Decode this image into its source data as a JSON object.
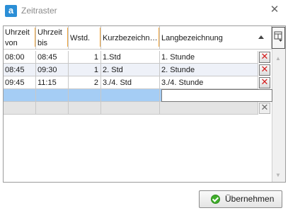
{
  "window": {
    "title": "Zeitraster",
    "app_icon_letter": "a",
    "close_glyph": "✕"
  },
  "table": {
    "headers": [
      {
        "line1": "Uhrzeit",
        "line2": "von"
      },
      {
        "line1": "Uhrzeit",
        "line2": "bis"
      },
      {
        "line1": "Wstd.",
        "line2": ""
      },
      {
        "line1": "Kurzbezeichn…",
        "line2": ""
      },
      {
        "line1": "Langbezeichnung",
        "line2": ""
      }
    ],
    "sort_column": "Langbezeichnung",
    "sort_direction": "ascending",
    "rows": [
      {
        "von": "08:00",
        "bis": "08:45",
        "wstd": "1",
        "kurz": "1.Std",
        "lang": "1. Stunde"
      },
      {
        "von": "08:45",
        "bis": "09:30",
        "wstd": "1",
        "kurz": "2. Std",
        "lang": "2. Stunde"
      },
      {
        "von": "09:45",
        "bis": "11:15",
        "wstd": "2",
        "kurz": "3./4. Std",
        "lang": "3./4. Stunde"
      }
    ],
    "delete_glyph": "✕"
  },
  "footer": {
    "ok_label": "Übernehmen"
  },
  "colors": {
    "selected_row": "#a5cdf5",
    "alt_row": "#eef1f8",
    "header_accent": "#f0a640",
    "delete_red": "#d41b1b",
    "ok_green": "#3fae2a"
  },
  "icons": {
    "app": "app-logo-icon",
    "close": "close-icon",
    "column_chooser": "column-chooser-icon",
    "delete": "delete-row-icon",
    "ok": "check-circle-icon",
    "sort": "sort-ascending-icon"
  }
}
